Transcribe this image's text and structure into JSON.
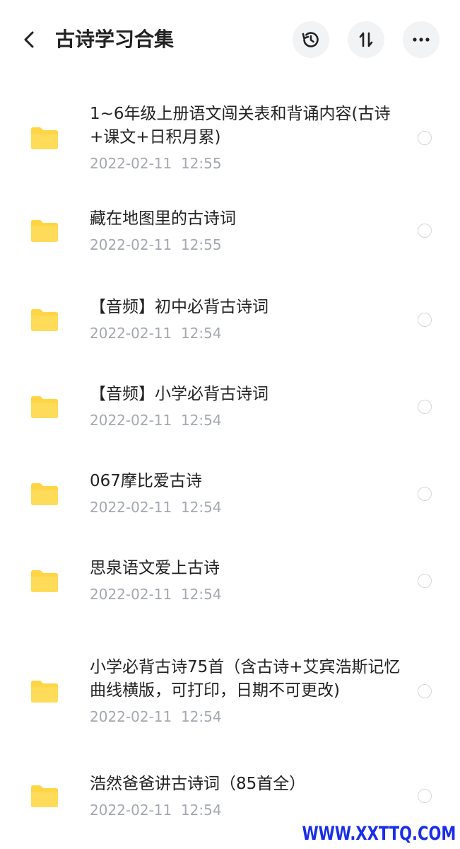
{
  "header": {
    "title": "古诗学习合集",
    "back_icon": "chevron-left-icon",
    "history_icon": "history-clock-icon",
    "sort_icon": "sort-arrows-icon",
    "more_icon": "more-dots-icon"
  },
  "colors": {
    "folder": "#FFD545",
    "header_button_bg": "#F2F3F5",
    "date_text": "#A4A8B0",
    "watermark": "#1A2EE8"
  },
  "items": [
    {
      "name": "1~6年级上册语文闯关表和背诵内容(古诗+课文+日积月累)",
      "date": "2022-02-11  12:55"
    },
    {
      "name": "藏在地图里的古诗词",
      "date": "2022-02-11  12:55"
    },
    {
      "name": "【音频】初中必背古诗词",
      "date": "2022-02-11  12:54"
    },
    {
      "name": "【音频】小学必背古诗词",
      "date": "2022-02-11  12:54"
    },
    {
      "name": "067摩比爱古诗",
      "date": "2022-02-11  12:54"
    },
    {
      "name": "思泉语文爱上古诗",
      "date": "2022-02-11  12:54"
    },
    {
      "name": "小学必背古诗75首（含古诗+艾宾浩斯记忆曲线横版，可打印，日期不可更改)",
      "date": "2022-02-11  12:54"
    },
    {
      "name": "浩然爸爸讲古诗词（85首全）",
      "date": "2022-02-11  12:54"
    }
  ],
  "watermark": "WWW.XXTTQ.COM"
}
